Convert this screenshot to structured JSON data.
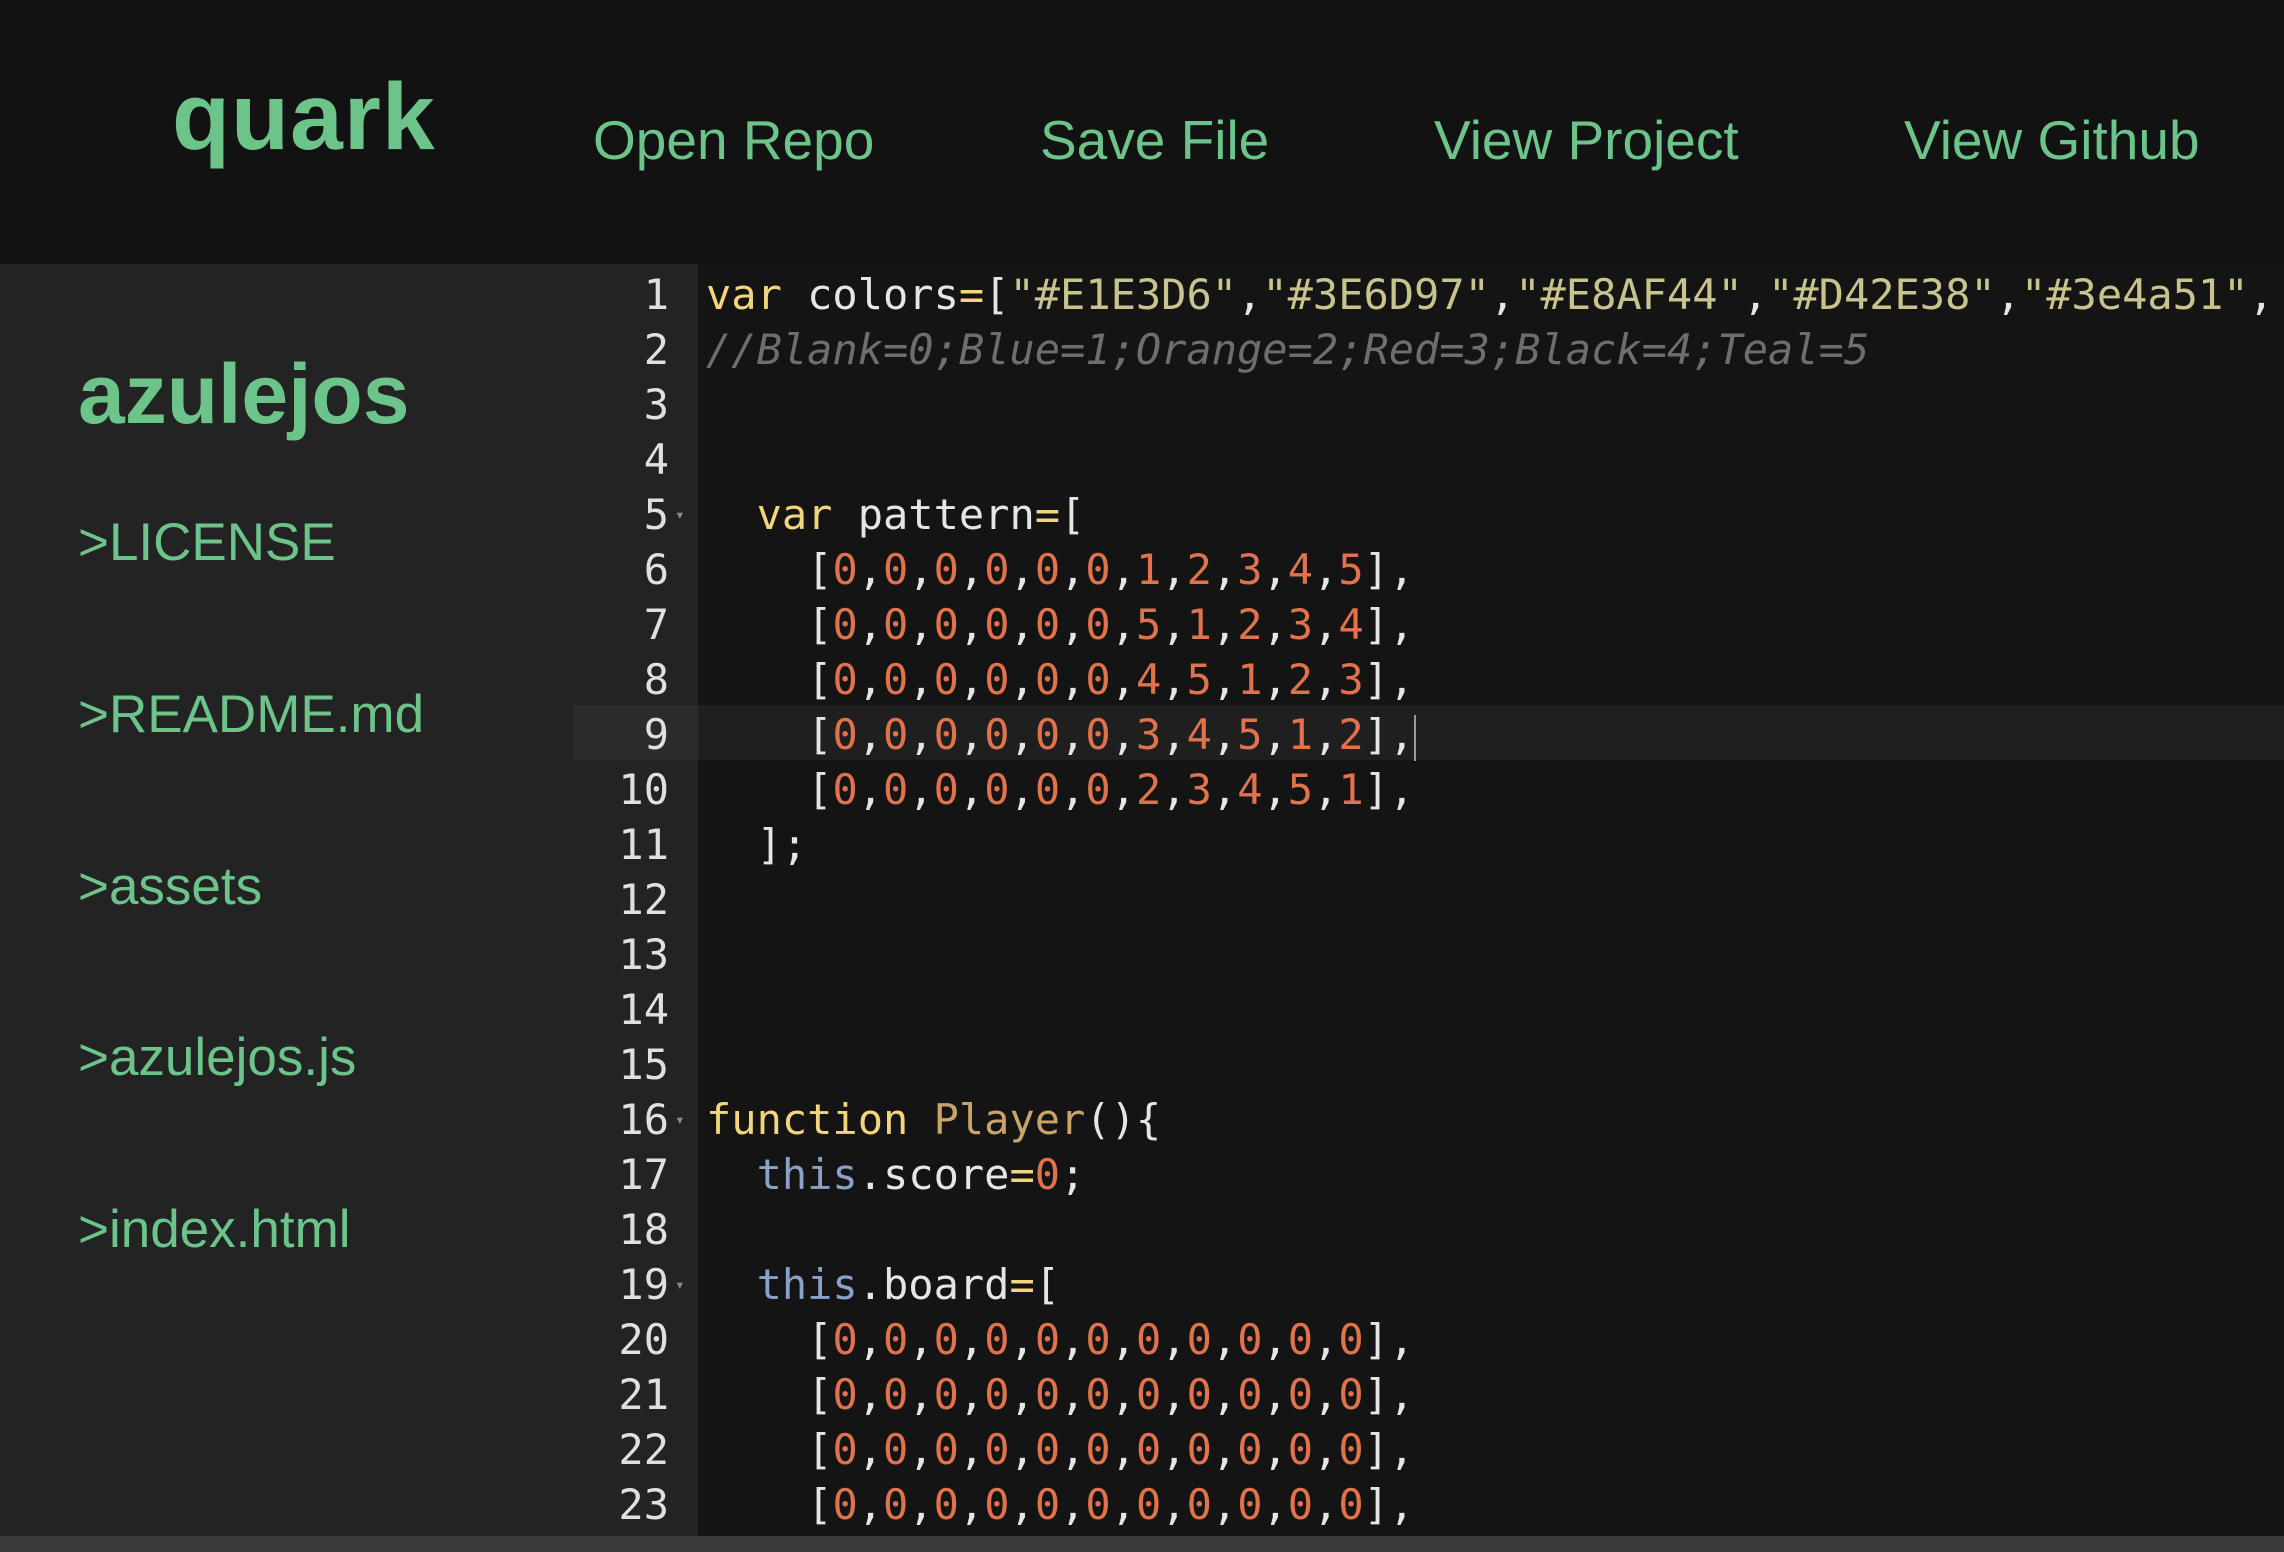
{
  "app": {
    "brand": "quark",
    "nav": [
      {
        "label": "Open Repo"
      },
      {
        "label": "Save File"
      },
      {
        "label": "View Project"
      },
      {
        "label": "View Github"
      }
    ]
  },
  "sidebar": {
    "repo_name": "azulejos",
    "files": [
      {
        "label": ">LICENSE"
      },
      {
        "label": ">README.md"
      },
      {
        "label": ">assets"
      },
      {
        "label": ">azulejos.js"
      },
      {
        "label": ">index.html"
      }
    ]
  },
  "editor": {
    "active_line": 9,
    "lines": [
      {
        "n": "1",
        "fold": false,
        "tokens": [
          {
            "t": "var",
            "c": "kw"
          },
          {
            "t": " colors",
            "c": "br"
          },
          {
            "t": "=",
            "c": "kw"
          },
          {
            "t": "[",
            "c": "br"
          },
          {
            "t": "\"#E1E3D6\"",
            "c": "str"
          },
          {
            "t": ",",
            "c": "br"
          },
          {
            "t": "\"#3E6D97\"",
            "c": "str"
          },
          {
            "t": ",",
            "c": "br"
          },
          {
            "t": "\"#E8AF44\"",
            "c": "str"
          },
          {
            "t": ",",
            "c": "br"
          },
          {
            "t": "\"#D42E38\"",
            "c": "str"
          },
          {
            "t": ",",
            "c": "br"
          },
          {
            "t": "\"#3e4a51\"",
            "c": "str"
          },
          {
            "t": ",",
            "c": "br"
          }
        ]
      },
      {
        "n": "2",
        "fold": false,
        "tokens": [
          {
            "t": "//Blank=0;Blue=1;Orange=2;Red=3;Black=4;Teal=5",
            "c": "cmt"
          }
        ]
      },
      {
        "n": "3",
        "fold": false,
        "tokens": []
      },
      {
        "n": "4",
        "fold": false,
        "tokens": []
      },
      {
        "n": "5",
        "fold": true,
        "tokens": [
          {
            "t": "  ",
            "c": "br"
          },
          {
            "t": "var",
            "c": "kw"
          },
          {
            "t": " pattern",
            "c": "br"
          },
          {
            "t": "=",
            "c": "kw"
          },
          {
            "t": "[",
            "c": "br"
          }
        ]
      },
      {
        "n": "6",
        "fold": false,
        "row": [
          "0",
          "0",
          "0",
          "0",
          "0",
          "0",
          "1",
          "2",
          "3",
          "4",
          "5"
        ]
      },
      {
        "n": "7",
        "fold": false,
        "row": [
          "0",
          "0",
          "0",
          "0",
          "0",
          "0",
          "5",
          "1",
          "2",
          "3",
          "4"
        ]
      },
      {
        "n": "8",
        "fold": false,
        "row": [
          "0",
          "0",
          "0",
          "0",
          "0",
          "0",
          "4",
          "5",
          "1",
          "2",
          "3"
        ]
      },
      {
        "n": "9",
        "fold": false,
        "row": [
          "0",
          "0",
          "0",
          "0",
          "0",
          "0",
          "3",
          "4",
          "5",
          "1",
          "2"
        ],
        "cursor": true
      },
      {
        "n": "10",
        "fold": false,
        "row": [
          "0",
          "0",
          "0",
          "0",
          "0",
          "0",
          "2",
          "3",
          "4",
          "5",
          "1"
        ]
      },
      {
        "n": "11",
        "fold": false,
        "tokens": [
          {
            "t": "  ];",
            "c": "br"
          }
        ]
      },
      {
        "n": "12",
        "fold": false,
        "tokens": []
      },
      {
        "n": "13",
        "fold": false,
        "tokens": []
      },
      {
        "n": "14",
        "fold": false,
        "tokens": []
      },
      {
        "n": "15",
        "fold": false,
        "tokens": []
      },
      {
        "n": "16",
        "fold": true,
        "tokens": [
          {
            "t": "function",
            "c": "kw"
          },
          {
            "t": " ",
            "c": "br"
          },
          {
            "t": "Player",
            "c": "fn"
          },
          {
            "t": "(){",
            "c": "br"
          }
        ]
      },
      {
        "n": "17",
        "fold": false,
        "tokens": [
          {
            "t": "  ",
            "c": "br"
          },
          {
            "t": "this",
            "c": "this"
          },
          {
            "t": ".score",
            "c": "br"
          },
          {
            "t": "=",
            "c": "kw"
          },
          {
            "t": "0",
            "c": "num"
          },
          {
            "t": ";",
            "c": "br"
          }
        ]
      },
      {
        "n": "18",
        "fold": false,
        "tokens": []
      },
      {
        "n": "19",
        "fold": true,
        "tokens": [
          {
            "t": "  ",
            "c": "br"
          },
          {
            "t": "this",
            "c": "this"
          },
          {
            "t": ".board",
            "c": "br"
          },
          {
            "t": "=",
            "c": "kw"
          },
          {
            "t": "[",
            "c": "br"
          }
        ]
      },
      {
        "n": "20",
        "fold": false,
        "row": [
          "0",
          "0",
          "0",
          "0",
          "0",
          "0",
          "0",
          "0",
          "0",
          "0",
          "0"
        ]
      },
      {
        "n": "21",
        "fold": false,
        "row": [
          "0",
          "0",
          "0",
          "0",
          "0",
          "0",
          "0",
          "0",
          "0",
          "0",
          "0"
        ]
      },
      {
        "n": "22",
        "fold": false,
        "row": [
          "0",
          "0",
          "0",
          "0",
          "0",
          "0",
          "0",
          "0",
          "0",
          "0",
          "0"
        ]
      },
      {
        "n": "23",
        "fold": false,
        "row": [
          "0",
          "0",
          "0",
          "0",
          "0",
          "0",
          "0",
          "0",
          "0",
          "0",
          "0"
        ]
      }
    ]
  }
}
